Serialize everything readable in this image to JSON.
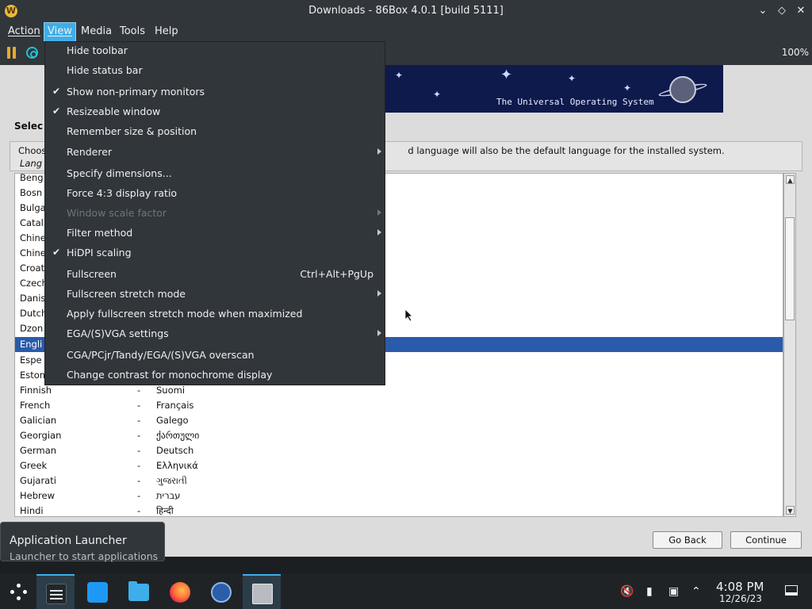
{
  "window": {
    "app_icon": "W",
    "title": "Downloads - 86Box 4.0.1 [build 5111]",
    "controls": [
      "chevron-down-icon",
      "diamond-icon",
      "close-icon"
    ]
  },
  "menubar": {
    "items": [
      {
        "label": "Action",
        "active": false
      },
      {
        "label": "View",
        "active": true
      },
      {
        "label": "Media",
        "active": false
      },
      {
        "label": "Tools",
        "active": false
      },
      {
        "label": "Help",
        "active": false
      }
    ]
  },
  "toolbar": {
    "zoom": "100%",
    "icons": [
      "pause-icon",
      "reset-icon"
    ]
  },
  "view_menu": {
    "items": [
      {
        "label": "Hide toolbar",
        "checked": false,
        "enabled": true,
        "submenu": false,
        "shortcut": ""
      },
      {
        "label": "Hide status bar",
        "checked": false,
        "enabled": true,
        "submenu": false,
        "shortcut": ""
      },
      {
        "label": "Show non-primary monitors",
        "checked": true,
        "enabled": true,
        "submenu": false,
        "shortcut": ""
      },
      {
        "label": "Resizeable window",
        "checked": true,
        "enabled": true,
        "submenu": false,
        "shortcut": ""
      },
      {
        "label": "Remember size & position",
        "checked": false,
        "enabled": true,
        "submenu": false,
        "shortcut": ""
      },
      {
        "label": "Renderer",
        "checked": false,
        "enabled": true,
        "submenu": true,
        "shortcut": ""
      },
      {
        "label": "Specify dimensions...",
        "checked": false,
        "enabled": true,
        "submenu": false,
        "shortcut": ""
      },
      {
        "label": "Force 4:3 display ratio",
        "checked": false,
        "enabled": true,
        "submenu": false,
        "shortcut": ""
      },
      {
        "label": "Window scale factor",
        "checked": false,
        "enabled": false,
        "submenu": true,
        "shortcut": ""
      },
      {
        "label": "Filter method",
        "checked": false,
        "enabled": true,
        "submenu": true,
        "shortcut": ""
      },
      {
        "label": "HiDPI scaling",
        "checked": true,
        "enabled": true,
        "submenu": false,
        "shortcut": ""
      },
      {
        "label": "Fullscreen",
        "checked": false,
        "enabled": true,
        "submenu": false,
        "shortcut": "Ctrl+Alt+PgUp"
      },
      {
        "label": "Fullscreen stretch mode",
        "checked": false,
        "enabled": true,
        "submenu": true,
        "shortcut": ""
      },
      {
        "label": "Apply fullscreen stretch mode when maximized",
        "checked": false,
        "enabled": true,
        "submenu": false,
        "shortcut": ""
      },
      {
        "label": "EGA/(S)VGA settings",
        "checked": false,
        "enabled": true,
        "submenu": true,
        "shortcut": ""
      },
      {
        "label": "CGA/PCjr/Tandy/EGA/(S)VGA overscan",
        "checked": false,
        "enabled": true,
        "submenu": false,
        "shortcut": ""
      },
      {
        "label": "Change contrast for monochrome display",
        "checked": false,
        "enabled": true,
        "submenu": false,
        "shortcut": ""
      }
    ]
  },
  "installer": {
    "banner_tagline": "The Universal Operating System",
    "heading_visible": "Selec",
    "instruction_prefix": "Choos",
    "instruction_visible": "d language will also be the default language for the installed system.",
    "instruction_line2": "Lang",
    "languages": [
      {
        "name": "Beng",
        "dash": "",
        "native": ""
      },
      {
        "name": "Bosn",
        "dash": "",
        "native": ""
      },
      {
        "name": "Bulga",
        "dash": "",
        "native": ""
      },
      {
        "name": "Catal",
        "dash": "",
        "native": ""
      },
      {
        "name": "Chine",
        "dash": "",
        "native": ""
      },
      {
        "name": "Chine",
        "dash": "",
        "native": ""
      },
      {
        "name": "Croat",
        "dash": "",
        "native": ""
      },
      {
        "name": "Czech",
        "dash": "",
        "native": ""
      },
      {
        "name": "Danis",
        "dash": "",
        "native": ""
      },
      {
        "name": "Dutch",
        "dash": "",
        "native": ""
      },
      {
        "name": "Dzon",
        "dash": "",
        "native": ""
      },
      {
        "name": "Engli",
        "dash": "",
        "native": "",
        "selected": true
      },
      {
        "name": "Espe",
        "dash": "",
        "native": ""
      },
      {
        "name": "Eston",
        "dash": "",
        "native": ""
      },
      {
        "name": "Finnish",
        "dash": "-",
        "native": "Suomi"
      },
      {
        "name": "French",
        "dash": "-",
        "native": "Français"
      },
      {
        "name": "Galician",
        "dash": "-",
        "native": "Galego"
      },
      {
        "name": "Georgian",
        "dash": "-",
        "native": "ქართული"
      },
      {
        "name": "German",
        "dash": "-",
        "native": "Deutsch"
      },
      {
        "name": "Greek",
        "dash": "-",
        "native": "Ελληνικά"
      },
      {
        "name": "Gujarati",
        "dash": "-",
        "native": "ગુજરાતી"
      },
      {
        "name": "Hebrew",
        "dash": "-",
        "native": "עברית"
      },
      {
        "name": "Hindi",
        "dash": "-",
        "native": "हिन्दी"
      }
    ],
    "go_back": "Go Back",
    "continue": "Continue"
  },
  "tooltip": {
    "title": "Application Launcher",
    "subtitle": "Launcher to start applications"
  },
  "taskbar": {
    "apps": [
      "application-launcher-icon",
      "system-settings-icon",
      "discover-store-icon",
      "file-manager-icon",
      "firefox-icon",
      "network-browser-icon",
      "86box-icon"
    ],
    "time": "4:08 PM",
    "date": "12/26/23",
    "tray_icons": [
      "volume-muted-icon",
      "battery-icon",
      "network-icon",
      "expand-tray-icon",
      "show-desktop-icon"
    ]
  }
}
